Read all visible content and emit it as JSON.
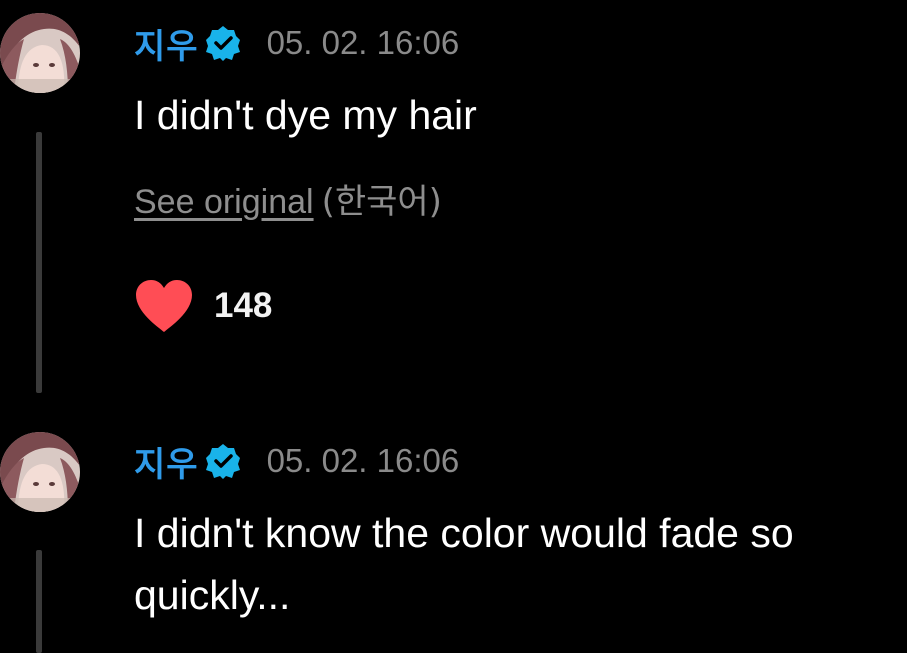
{
  "comments": [
    {
      "author": "지우",
      "verified": true,
      "timestamp": "05. 02. 16:06",
      "text": "I didn't dye my hair",
      "see_original_label": "See original",
      "original_language": "(한국어)",
      "like_count": "148",
      "liked": true
    },
    {
      "author": "지우",
      "verified": true,
      "timestamp": "05. 02. 16:06",
      "text": "I didn't know the color would fade so quickly..."
    }
  ],
  "colors": {
    "background": "#000000",
    "author_name": "#2f9bea",
    "verified_badge": "#19b3ea",
    "timestamp": "#8a8a8a",
    "body_text": "#ffffff",
    "link_text": "#8e8e8e",
    "heart": "#ff4d55"
  },
  "icons": {
    "verified": "verified-badge-icon",
    "like": "heart-icon"
  }
}
